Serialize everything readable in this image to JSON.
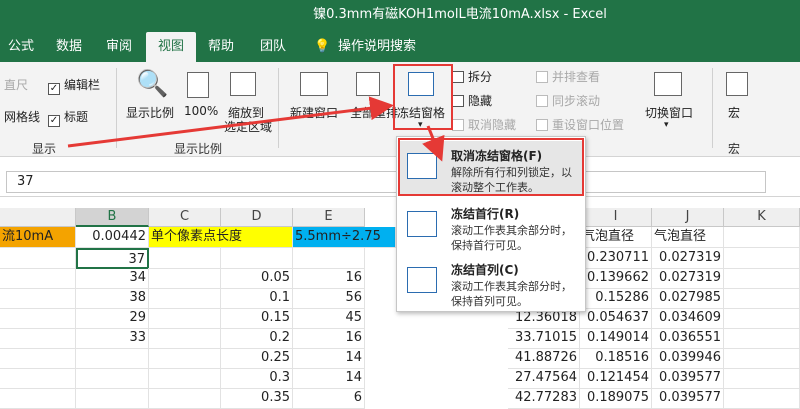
{
  "window": {
    "title": "镍0.3mm有磁KOH1molL电流10mA.xlsx  -  Excel"
  },
  "tabs": [
    "公式",
    "数据",
    "审阅",
    "视图",
    "帮助",
    "团队"
  ],
  "tell_me": "操作说明搜索",
  "ribbon": {
    "show": {
      "ruler": "直尺",
      "formula_bar": "编辑栏",
      "gridlines": "网格线",
      "headings": "标题",
      "group": "显示"
    },
    "zoom": {
      "zoom": "显示比例",
      "hundred": "100%",
      "fit": "缩放到",
      "fit2": "选定区域",
      "group": "显示比例"
    },
    "window": {
      "new": "新建窗口",
      "arrange": "全部重排",
      "freeze": "冻结窗格",
      "split": "拆分",
      "hide": "隐藏",
      "unhide": "取消隐藏",
      "side": "并排查看",
      "sync": "同步滚动",
      "reset": "重设窗口位置",
      "switch": "切换窗口",
      "macro": "宏",
      "macro_group": "宏"
    }
  },
  "formula_bar": {
    "value": "37"
  },
  "columns": [
    "B",
    "C",
    "D",
    "E",
    "I",
    "J",
    "K"
  ],
  "sheet": {
    "header_row": {
      "a": "流10mA",
      "b": "0.00442",
      "c": "单个像素点长度",
      "e": "5.5mm÷2.75",
      "i": "气泡直径",
      "j": "气泡直径"
    },
    "rows": [
      {
        "b": "37",
        "d": "",
        "e": "",
        "h": "",
        "i": "0.230711",
        "j": "0.027319"
      },
      {
        "b": "34",
        "d": "0.05",
        "e": "16",
        "h": "",
        "i": "0.139662",
        "j": "0.027319"
      },
      {
        "b": "38",
        "d": "0.1",
        "e": "56",
        "h": "",
        "i": "0.15286",
        "j": "0.027985"
      },
      {
        "b": "29",
        "d": "0.15",
        "e": "45",
        "h": "12.36018",
        "i": "0.054637",
        "j": "0.034609"
      },
      {
        "b": "33",
        "d": "0.2",
        "e": "16",
        "h": "33.71015",
        "i": "0.149014",
        "j": "0.036551"
      },
      {
        "b": "",
        "d": "0.25",
        "e": "14",
        "h": "41.88726",
        "i": "0.18516",
        "j": "0.039946"
      },
      {
        "b": "",
        "d": "0.3",
        "e": "14",
        "h": "27.47564",
        "i": "0.121454",
        "j": "0.039577"
      },
      {
        "b": "",
        "d": "0.35",
        "e": "6",
        "h": "42.77283",
        "i": "0.189075",
        "j": "0.039577"
      }
    ]
  },
  "dropdown": {
    "items": [
      {
        "title": "取消冻结窗格(F)",
        "desc": "解除所有行和列锁定，以滚动整个工作表。"
      },
      {
        "title": "冻结首行(R)",
        "desc": "滚动工作表其余部分时，保持首行可见。"
      },
      {
        "title": "冻结首列(C)",
        "desc": "滚动工作表其余部分时，保持首列可见。"
      }
    ]
  },
  "colors": {
    "excel_green": "#217346",
    "highlight_yellow": "#ffff00",
    "highlight_orange": "#f4a300",
    "highlight_cyan": "#00b0f0",
    "annotation_red": "#e53935"
  }
}
